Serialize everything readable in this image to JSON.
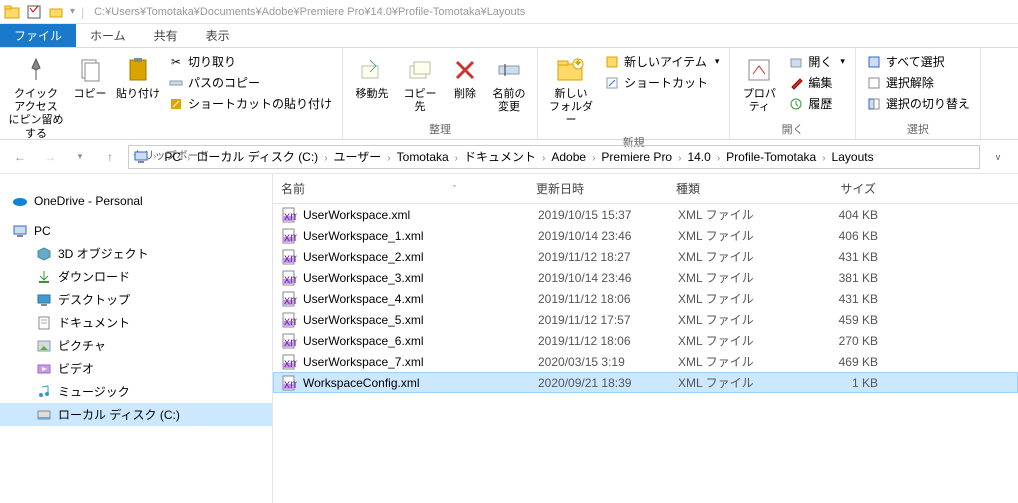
{
  "title_path": "C:¥Users¥Tomotaka¥Documents¥Adobe¥Premiere Pro¥14.0¥Profile-Tomotaka¥Layouts",
  "tabs": {
    "file": "ファイル",
    "home": "ホーム",
    "share": "共有",
    "view": "表示"
  },
  "ribbon": {
    "clipboard": {
      "label": "クリップボード",
      "quick_access": "クイック アクセス\nにピン留めする",
      "copy": "コピー",
      "paste": "貼り付け",
      "cut": "切り取り",
      "copy_path": "パスのコピー",
      "paste_shortcut": "ショートカットの貼り付け"
    },
    "organize": {
      "label": "整理",
      "move_to": "移動先",
      "copy_to": "コピー先",
      "delete": "削除",
      "rename": "名前の\n変更"
    },
    "new": {
      "label": "新規",
      "new_folder": "新しい\nフォルダー",
      "new_item": "新しいアイテム",
      "shortcut": "ショートカット"
    },
    "open": {
      "label": "開く",
      "properties": "プロパ\nティ",
      "open": "開く",
      "edit": "編集",
      "history": "履歴"
    },
    "select": {
      "label": "選択",
      "select_all": "すべて選択",
      "select_none": "選択解除",
      "invert": "選択の切り替え"
    }
  },
  "breadcrumbs": [
    "PC",
    "ローカル ディスク (C:)",
    "ユーザー",
    "Tomotaka",
    "ドキュメント",
    "Adobe",
    "Premiere Pro",
    "14.0",
    "Profile-Tomotaka",
    "Layouts"
  ],
  "sidebar": {
    "onedrive": "OneDrive - Personal",
    "pc": "PC",
    "items": [
      {
        "label": "3D オブジェクト",
        "icon": "cube"
      },
      {
        "label": "ダウンロード",
        "icon": "download"
      },
      {
        "label": "デスクトップ",
        "icon": "desktop"
      },
      {
        "label": "ドキュメント",
        "icon": "document"
      },
      {
        "label": "ピクチャ",
        "icon": "picture"
      },
      {
        "label": "ビデオ",
        "icon": "video"
      },
      {
        "label": "ミュージック",
        "icon": "music"
      }
    ],
    "local_disk": "ローカル ディスク (C:)"
  },
  "columns": {
    "name": "名前",
    "date": "更新日時",
    "type": "種類",
    "size": "サイズ"
  },
  "files": [
    {
      "name": "UserWorkspace.xml",
      "date": "2019/10/15 15:37",
      "type": "XML ファイル",
      "size": "404 KB",
      "selected": false
    },
    {
      "name": "UserWorkspace_1.xml",
      "date": "2019/10/14 23:46",
      "type": "XML ファイル",
      "size": "406 KB",
      "selected": false
    },
    {
      "name": "UserWorkspace_2.xml",
      "date": "2019/11/12 18:27",
      "type": "XML ファイル",
      "size": "431 KB",
      "selected": false
    },
    {
      "name": "UserWorkspace_3.xml",
      "date": "2019/10/14 23:46",
      "type": "XML ファイル",
      "size": "381 KB",
      "selected": false
    },
    {
      "name": "UserWorkspace_4.xml",
      "date": "2019/11/12 18:06",
      "type": "XML ファイル",
      "size": "431 KB",
      "selected": false
    },
    {
      "name": "UserWorkspace_5.xml",
      "date": "2019/11/12 17:57",
      "type": "XML ファイル",
      "size": "459 KB",
      "selected": false
    },
    {
      "name": "UserWorkspace_6.xml",
      "date": "2019/11/12 18:06",
      "type": "XML ファイル",
      "size": "270 KB",
      "selected": false
    },
    {
      "name": "UserWorkspace_7.xml",
      "date": "2020/03/15 3:19",
      "type": "XML ファイル",
      "size": "469 KB",
      "selected": false
    },
    {
      "name": "WorkspaceConfig.xml",
      "date": "2020/09/21 18:39",
      "type": "XML ファイル",
      "size": "1 KB",
      "selected": true
    }
  ]
}
